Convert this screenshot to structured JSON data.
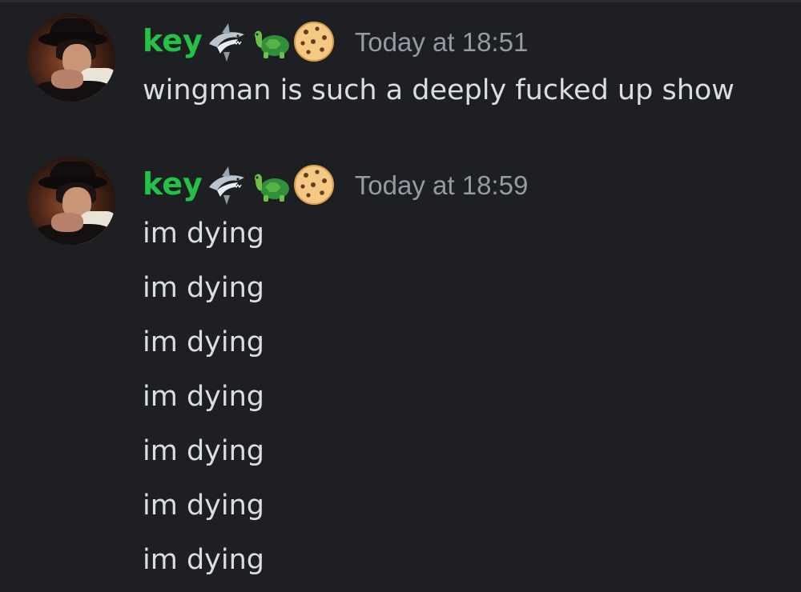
{
  "messages": [
    {
      "author": "key",
      "author_color": "#23c146",
      "badges": [
        "shark-emoji",
        "turtle-emoji",
        "cookie-emoji"
      ],
      "timestamp": "Today at 18:51",
      "lines": [
        "wingman is such a deeply fucked up show"
      ]
    },
    {
      "author": "key",
      "author_color": "#23c146",
      "badges": [
        "shark-emoji",
        "turtle-emoji",
        "cookie-emoji"
      ],
      "timestamp": "Today at 18:59",
      "lines": [
        "im dying",
        "im dying",
        "im dying",
        "im dying",
        "im dying",
        "im dying",
        "im dying"
      ]
    }
  ],
  "colors": {
    "background": "#1e1f22",
    "text": "#dbdee1",
    "timestamp": "#949ba4",
    "username": "#23c146"
  }
}
